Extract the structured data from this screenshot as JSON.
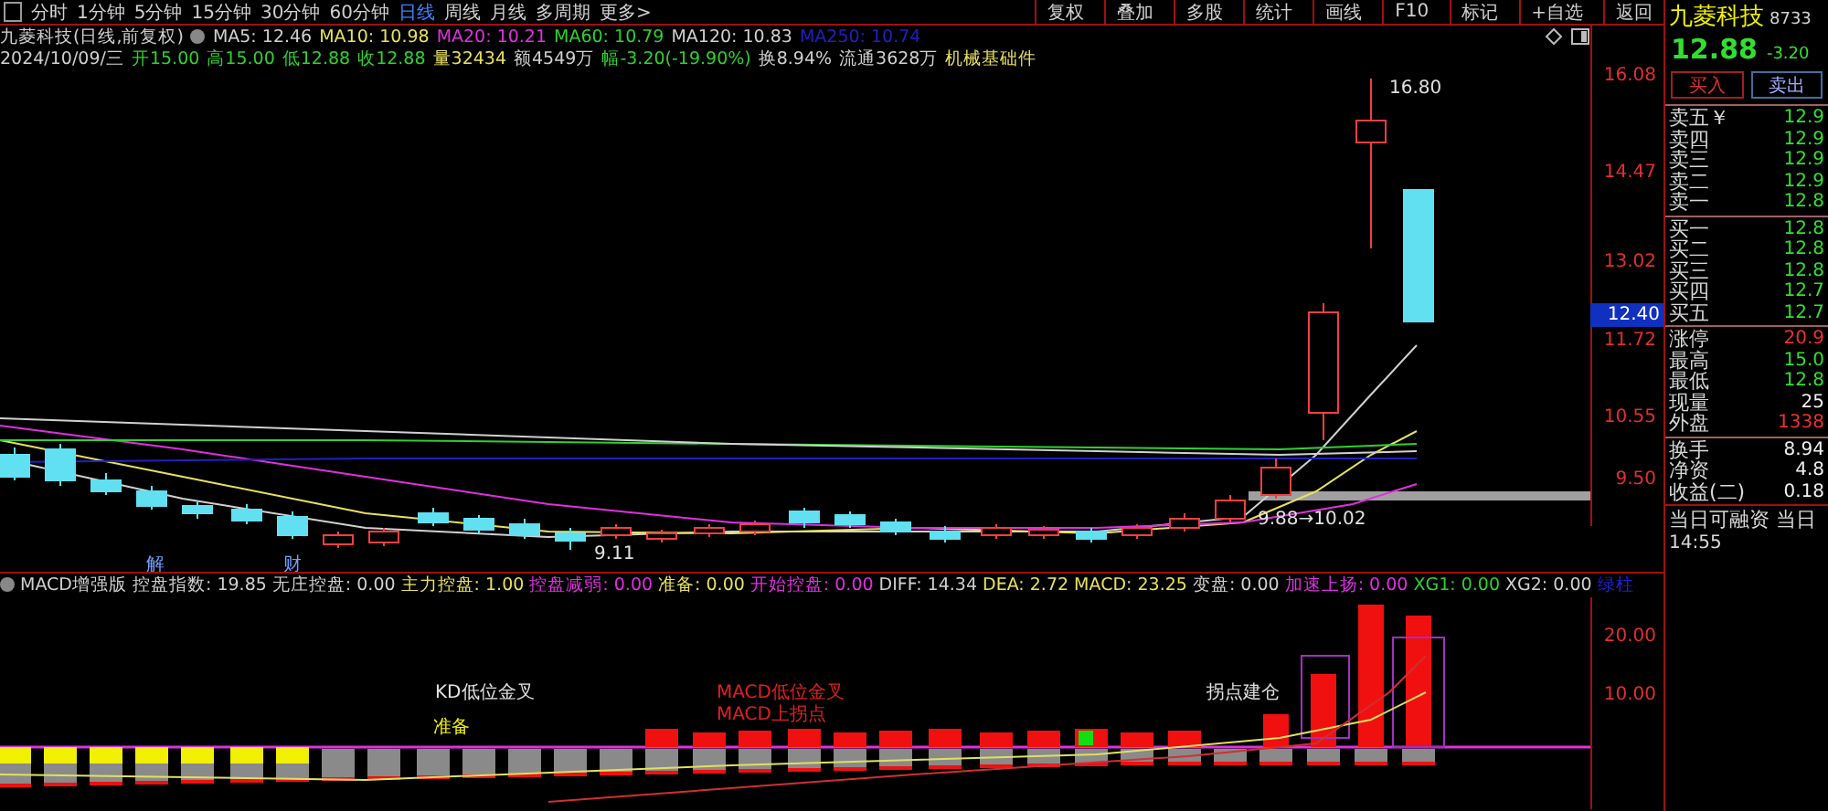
{
  "toolbar": {
    "periods": [
      {
        "label": "分时",
        "selected": false
      },
      {
        "label": "1分钟",
        "selected": false
      },
      {
        "label": "5分钟",
        "selected": false
      },
      {
        "label": "15分钟",
        "selected": false
      },
      {
        "label": "30分钟",
        "selected": false
      },
      {
        "label": "60分钟",
        "selected": false
      },
      {
        "label": "日线",
        "selected": true
      },
      {
        "label": "周线",
        "selected": false
      },
      {
        "label": "月线",
        "selected": false
      },
      {
        "label": "多周期",
        "selected": false
      },
      {
        "label": "更多>",
        "selected": false
      }
    ],
    "buttons": [
      "复权",
      "叠加",
      "多股",
      "统计",
      "画线",
      "F10",
      "标记",
      "+自选",
      "返回"
    ]
  },
  "legend": {
    "title": "九菱科技(日线,前复权)",
    "ma": [
      {
        "label": "MA5: 12.46",
        "color": "#d0d0d0"
      },
      {
        "label": "MA10: 10.98",
        "color": "#e8e060"
      },
      {
        "label": "MA20: 10.21",
        "color": "#e030e0"
      },
      {
        "label": "MA60: 10.79",
        "color": "#30d030"
      },
      {
        "label": "MA120: 10.83",
        "color": "#d0d0d0"
      },
      {
        "label": "MA250: 10.74",
        "color": "#2020c0"
      }
    ],
    "info": [
      {
        "text": "2024/10/09/三",
        "color": "#d0d0d0"
      },
      {
        "text": "开15.00",
        "color": "#30d030"
      },
      {
        "text": "高15.00",
        "color": "#30d030"
      },
      {
        "text": "低12.88",
        "color": "#30d030"
      },
      {
        "text": "收12.88",
        "color": "#30d030"
      },
      {
        "text": "量32434",
        "color": "#e8e060"
      },
      {
        "text": "额4549万",
        "color": "#d0d0d0"
      },
      {
        "text": "幅-3.20(-19.90%)",
        "color": "#30d030"
      },
      {
        "text": "换8.94%",
        "color": "#d0d0d0"
      },
      {
        "text": "流通3628万",
        "color": "#d0d0d0"
      },
      {
        "text": "机械基础件",
        "color": "#e8e060"
      }
    ]
  },
  "chart": {
    "price_axis": [
      "16.08",
      "14.47",
      "13.02",
      "11.72",
      "10.55",
      "9.50"
    ],
    "current_price": "12.40",
    "marks": [
      "16.80",
      "9.11",
      "9.88→10.02",
      "解",
      "财"
    ]
  },
  "indicator": {
    "name": "MACD增强版",
    "values": [
      {
        "text": "控盘指数: 19.85",
        "color": "#d0d0d0"
      },
      {
        "text": "无庄控盘: 0.00",
        "color": "#d0d0d0"
      },
      {
        "text": "主力控盘: 1.00",
        "color": "#e8e060"
      },
      {
        "text": "控盘减弱: 0.00",
        "color": "#e030e0"
      },
      {
        "text": "准备: 0.00",
        "color": "#e8e060"
      },
      {
        "text": "开始控盘: 0.00",
        "color": "#e030e0"
      },
      {
        "text": "DIFF: 14.34",
        "color": "#d0d0d0"
      },
      {
        "text": "DEA: 2.72",
        "color": "#e8e060"
      },
      {
        "text": "MACD: 23.25",
        "color": "#e8e060"
      },
      {
        "text": "变盘: 0.00",
        "color": "#d0d0d0"
      },
      {
        "text": "加速上扬: 0.00",
        "color": "#e030e0"
      },
      {
        "text": "XG1: 0.00",
        "color": "#30d030"
      },
      {
        "text": "XG2: 0.00",
        "color": "#d0d0d0"
      },
      {
        "text": "绿柱",
        "color": "#2020e0"
      }
    ],
    "axis": [
      "20.00",
      "10.00"
    ],
    "signals": [
      {
        "text": "KD低位金叉",
        "color": "#e0e0e0"
      },
      {
        "text": "准备",
        "color": "#f0f000"
      },
      {
        "text": "MACD低位金叉",
        "color": "#e02020"
      },
      {
        "text": "MACD上拐点",
        "color": "#e02020"
      },
      {
        "text": "拐点建仓",
        "color": "#e0e0e0"
      }
    ]
  },
  "quote": {
    "name": "九菱科技",
    "code": "8733",
    "price": "12.88",
    "change": "-3.20",
    "buy": "买入",
    "sell": "卖出",
    "groups": [
      [
        {
          "label": "卖五￥",
          "value": "12.9",
          "color": "#30e030"
        },
        {
          "label": "卖四",
          "value": "12.9",
          "color": "#30e030"
        },
        {
          "label": "卖三",
          "value": "12.9",
          "color": "#30e030"
        },
        {
          "label": "卖二",
          "value": "12.9",
          "color": "#30e030"
        },
        {
          "label": "卖一",
          "value": "12.8",
          "color": "#30e030"
        }
      ],
      [
        {
          "label": "买一",
          "value": "12.8",
          "color": "#30e030"
        },
        {
          "label": "买二",
          "value": "12.8",
          "color": "#30e030"
        },
        {
          "label": "买三",
          "value": "12.8",
          "color": "#30e030"
        },
        {
          "label": "买四",
          "value": "12.7",
          "color": "#30e030"
        },
        {
          "label": "买五",
          "value": "12.7",
          "color": "#30e030"
        }
      ],
      [
        {
          "label": "涨停",
          "value": "20.9",
          "color": "#f03030"
        },
        {
          "label": "最高",
          "value": "15.0",
          "color": "#30e030"
        },
        {
          "label": "最低",
          "value": "12.8",
          "color": "#30e030"
        },
        {
          "label": "现量",
          "value": "25",
          "color": "#f0f0f0"
        },
        {
          "label": "外盘",
          "value": "1338",
          "color": "#f03030"
        }
      ],
      [
        {
          "label": "换手",
          "value": "8.94",
          "color": "#f0f0f0"
        },
        {
          "label": "净资",
          "value": "4.8",
          "color": "#f0f0f0"
        },
        {
          "label": "收益(二)",
          "value": "0.18",
          "color": "#f0f0f0"
        }
      ]
    ],
    "footer": "当日可融资 当日",
    "time": "14:55"
  }
}
